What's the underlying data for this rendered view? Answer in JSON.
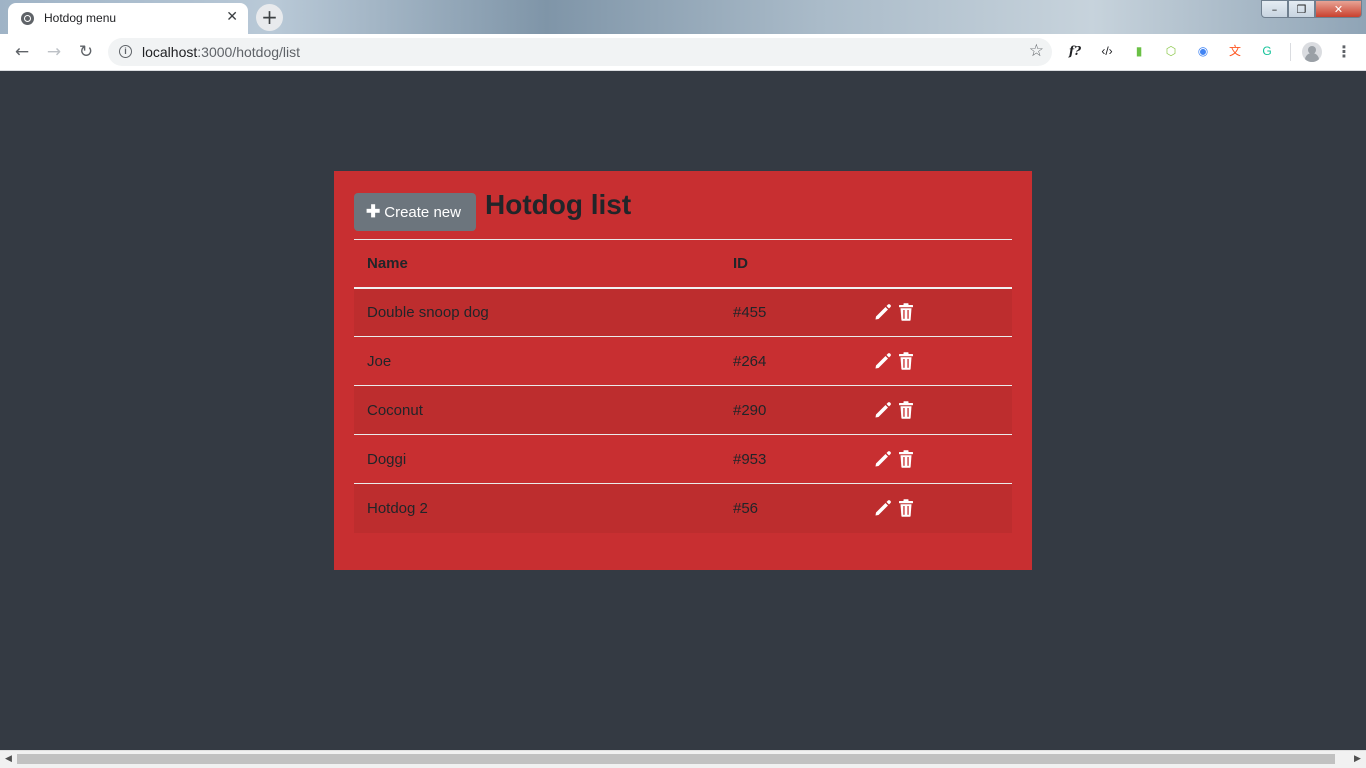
{
  "browser": {
    "tab_title": "Hotdog menu",
    "tab_close": "✕",
    "new_tab": "+",
    "url_host": "localhost",
    "url_rest": ":3000/hotdog/list",
    "back": "←",
    "forward": "→",
    "reload": "↻",
    "star": "☆",
    "menu": "⋮",
    "window_min": "–",
    "window_max": "❐",
    "window_close": "✕",
    "extensions": [
      {
        "name": "formula-extension-icon",
        "glyph": "f?",
        "color": "#202124"
      },
      {
        "name": "code-extension-icon",
        "glyph": "‹/›",
        "color": "#202124"
      },
      {
        "name": "evernote-extension-icon",
        "glyph": "▮",
        "color": "#6ac045"
      },
      {
        "name": "nodejs-extension-icon",
        "glyph": "⬡",
        "color": "#8cc84b"
      },
      {
        "name": "color-picker-extension-icon",
        "glyph": "◉",
        "color": "#4285f4"
      },
      {
        "name": "translate-extension-icon",
        "glyph": "文",
        "color": "#ff5722"
      },
      {
        "name": "grammarly-extension-icon",
        "glyph": "G",
        "color": "#15c39a"
      }
    ]
  },
  "page": {
    "create_button_label": "Create new",
    "title": "Hotdog list",
    "columns": {
      "name": "Name",
      "id": "ID"
    },
    "rows": [
      {
        "name": "Double snoop dog",
        "id": "#455"
      },
      {
        "name": "Joe",
        "id": "#264"
      },
      {
        "name": "Coconut",
        "id": "#290"
      },
      {
        "name": "Doggi",
        "id": "#953"
      },
      {
        "name": "Hotdog 2",
        "id": "#56"
      }
    ]
  },
  "colors": {
    "page_background": "#343a43",
    "card_background": "#c82f31",
    "striped_row": "#bd2d2e",
    "button_gray": "#6c757d"
  }
}
